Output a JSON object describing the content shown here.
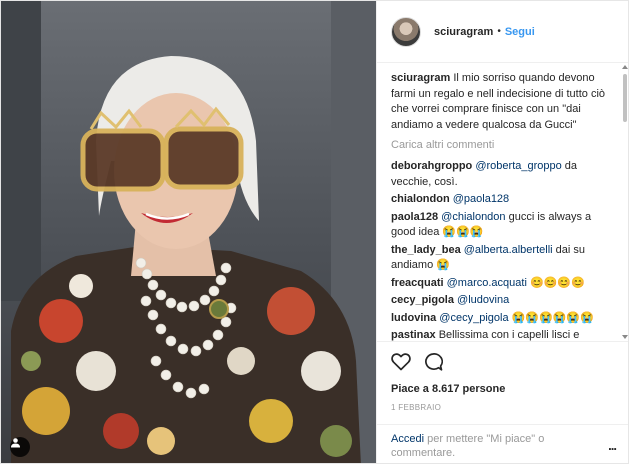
{
  "post": {
    "username": "sciuragram",
    "separator": "•",
    "follow_label": "Segui",
    "caption": {
      "user": "sciuragram",
      "text": "Il mio sorriso quando devono farmi un regalo e nell indecisione di tutto ciò che vorrei comprare finisce con un \"dai andiamo a vedere qualcosa da Gucci\""
    },
    "load_more_label": "Carica altri commenti",
    "comments": [
      {
        "user": "deborahgroppo",
        "mention": "@roberta_groppo",
        "text": " da vecchie, così."
      },
      {
        "user": "chialondon",
        "mention": "@paola128",
        "text": ""
      },
      {
        "user": "paola128",
        "mention": "@chialondon",
        "text": " gucci is always a good idea 😭😭😭"
      },
      {
        "user": "the_lady_bea",
        "mention": "@alberta.albertelli",
        "text": " dai su andiamo 😭"
      },
      {
        "user": "freacquati",
        "mention": "@marco.acquati",
        "text": " 😊😊😊😊"
      },
      {
        "user": "cecy_pigola",
        "mention": "@ludovina",
        "text": ""
      },
      {
        "user": "ludovina",
        "mention": "@cecy_pigola",
        "text": " 😭😭😭😭😭😭"
      },
      {
        "user": "pastinax",
        "mention": "",
        "text": "Bellissima con i capelli lisci e"
      }
    ],
    "likes_text": "Piace a 8.617 persone",
    "date_text": "1 FEBBRAIO",
    "footer": {
      "login_label": "Accedi",
      "rest": " per mettere \"Mi piace\" o commentare.",
      "more_label": "..."
    }
  },
  "icons": {
    "heart": "heart-outline",
    "comment": "speech-bubble",
    "tag": "person-tag",
    "options": "ellipsis"
  },
  "colors": {
    "link": "#003569",
    "follow": "#3897f0",
    "muted": "#999999"
  }
}
